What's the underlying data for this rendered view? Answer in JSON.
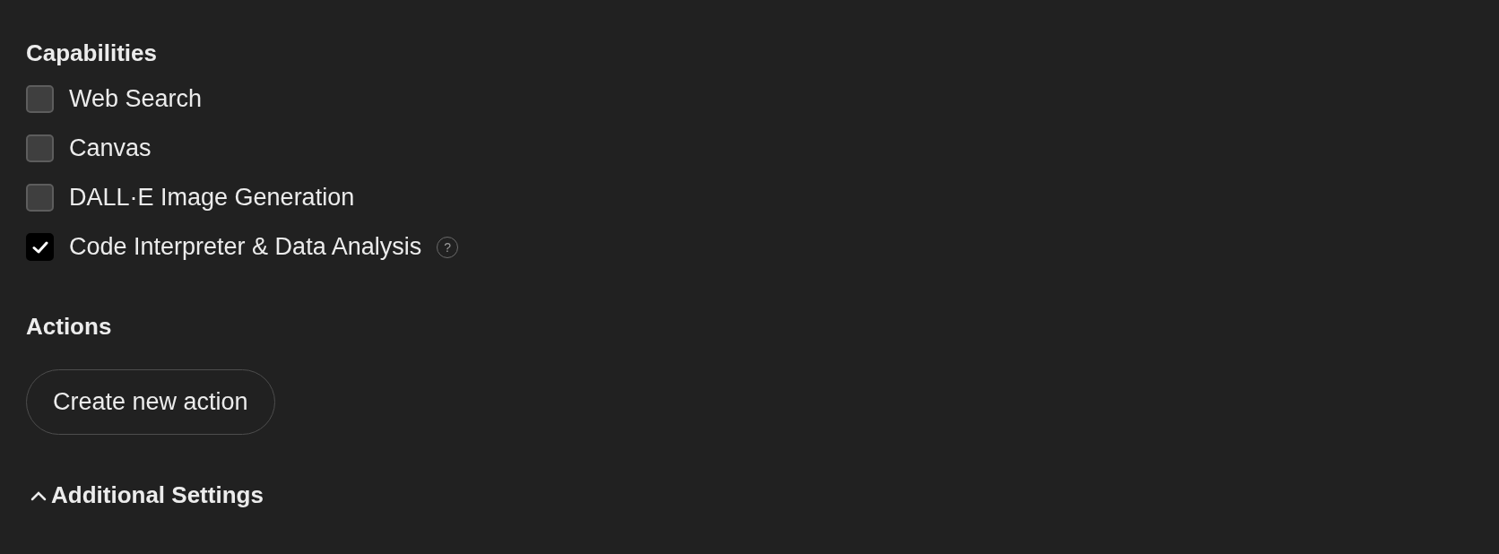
{
  "capabilities": {
    "title": "Capabilities",
    "items": [
      {
        "label": "Web Search",
        "checked": false
      },
      {
        "label": "Canvas",
        "checked": false
      },
      {
        "label": "DALL·E Image Generation",
        "checked": false
      },
      {
        "label": "Code Interpreter & Data Analysis",
        "checked": true,
        "help": "?"
      }
    ]
  },
  "actions": {
    "title": "Actions",
    "button": "Create new action"
  },
  "additional_settings": {
    "label": "Additional Settings",
    "expanded": true
  }
}
